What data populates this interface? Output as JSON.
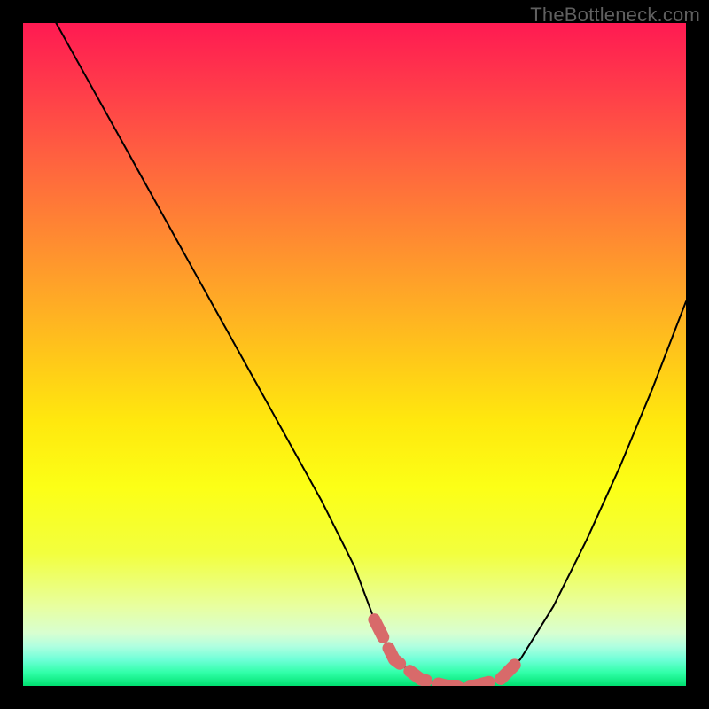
{
  "watermark": "TheBottleneck.com",
  "chart_data": {
    "type": "line",
    "title": "",
    "xlabel": "",
    "ylabel": "",
    "xlim": [
      0,
      100
    ],
    "ylim": [
      0,
      100
    ],
    "series": [
      {
        "name": "curve",
        "x": [
          5,
          10,
          15,
          20,
          25,
          30,
          35,
          40,
          45,
          50,
          53,
          56,
          60,
          64,
          68,
          72,
          75,
          80,
          85,
          90,
          95,
          100
        ],
        "y": [
          100,
          91,
          82,
          73,
          64,
          55,
          46,
          37,
          28,
          18,
          10,
          4,
          1,
          0,
          0,
          1,
          4,
          12,
          22,
          33,
          45,
          58
        ]
      }
    ],
    "thick_segment": {
      "name": "highlight",
      "color": "#d86a6a",
      "x": [
        53,
        56,
        60,
        64,
        68,
        72,
        75
      ],
      "y": [
        10,
        4,
        1,
        0,
        0,
        1,
        4
      ]
    }
  }
}
